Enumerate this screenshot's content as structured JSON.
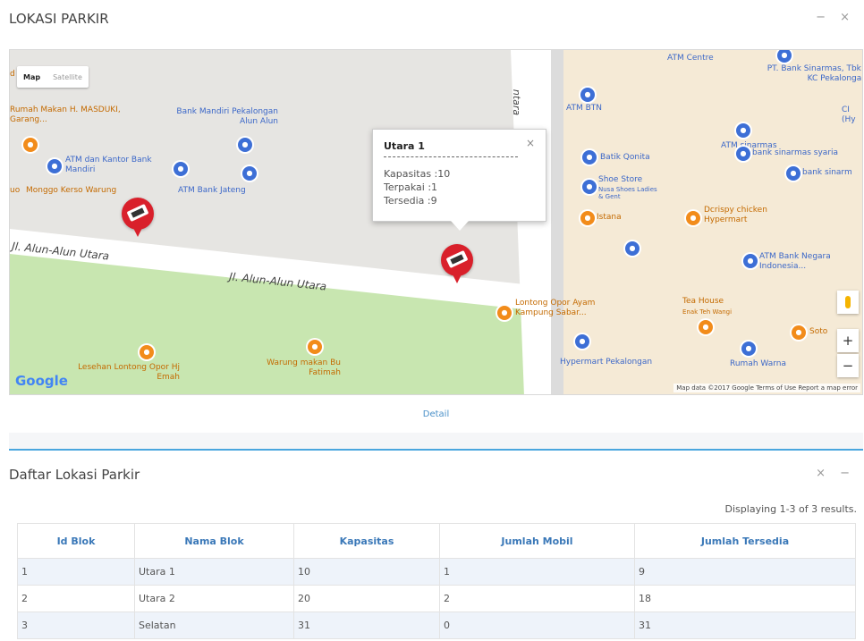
{
  "top_panel": {
    "title": "LOKASI PARKIR",
    "tools": "− ×"
  },
  "map": {
    "type_buttons": [
      "Map",
      "Satellite"
    ],
    "street_labels": [
      "Jl. Alun-Alun Utara",
      "Jl. Alun-Alun Utara",
      "ntara"
    ],
    "pois": {
      "rumah_makan": "Rumah Makan H. MASDUKI, Garang...",
      "bank_mandiri": "Bank Mandiri Pekalongan Alun Alun",
      "atm_mandiri": "ATM dan Kantor Bank Mandiri",
      "monggo": "Monggo Kerso Warung",
      "atm_jateng": "ATM Bank Jateng",
      "juo": "uo",
      "atm_centre": "ATM Centre",
      "bank_sinarmas": "PT. Bank Sinarmas, Tbk - KC Pekalongan",
      "atm_btn": "ATM BTN",
      "ci": "CI (Hy",
      "atm_sinarmas": "ATM sinarmas",
      "batik_qonita": "Batik Qonita",
      "bank_sinarmas_syariah": "bank sinarmas syaria",
      "shoe_store": "Shoe Store",
      "shoe_sub": "Nusa Shoes Ladies & Gent",
      "bank_sinarmas2": "bank sinarm",
      "istana": "Istana",
      "dcrispy": "Dcrispy chicken Hypermart",
      "atm_bni": "ATM Bank Negara Indonesia...",
      "lontong": "Lontong Opor Ayam Kampung Sabar...",
      "tea_house": "Tea House",
      "tea_sub": "Enak Teh Wangi",
      "soto": "Soto",
      "hypermart": "Hypermart Pekalongan",
      "rumah_warna": "Rumah Warna",
      "lesehan": "Lesehan Lontong Opor Hj Emah",
      "warung_fatimah": "Warung makan Bu Fatimah",
      "d_label": "d"
    },
    "infowindow": {
      "title": "Utara 1",
      "close": "×",
      "lines": [
        "Kapasitas :10",
        "Terpakai :1",
        "Tersedia :9"
      ]
    },
    "google_logo": "Google",
    "attribution": "Map data ©2017 Google   Terms of Use   Report a map error",
    "zoom_in": "+",
    "zoom_out": "−"
  },
  "detail_link": "Detail",
  "list_panel": {
    "title": "Daftar Lokasi Parkir",
    "tools": "× −",
    "summary": "Displaying 1-3 of 3 results.",
    "headers": [
      "Id Blok",
      "Nama Blok",
      "Kapasitas",
      "Jumlah Mobil",
      "Jumlah Tersedia"
    ],
    "rows": [
      [
        "1",
        "Utara 1",
        "10",
        "1",
        "9"
      ],
      [
        "2",
        "Utara 2",
        "20",
        "2",
        "18"
      ],
      [
        "3",
        "Selatan",
        "31",
        "0",
        "31"
      ]
    ]
  }
}
